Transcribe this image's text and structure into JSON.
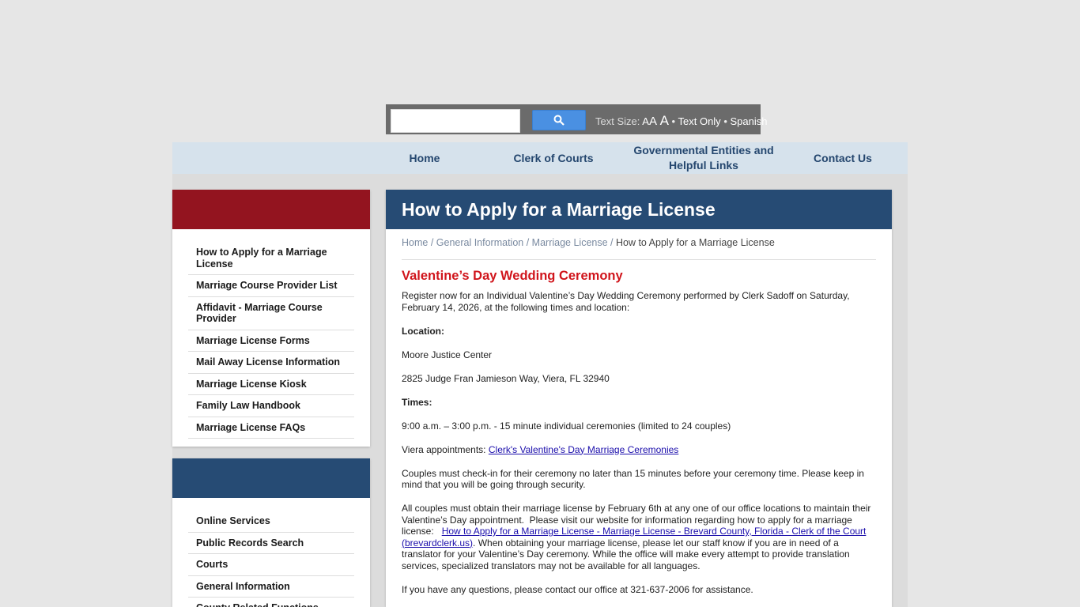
{
  "utility": {
    "search_placeholder": "",
    "text_size_label": "Text Size:",
    "size_small": "A",
    "size_medium": "A",
    "size_large": "A",
    "bullet1": "•",
    "text_only": "Text Only",
    "bullet2": "•",
    "spanish": "Spanish"
  },
  "nav": {
    "items": [
      {
        "label": "Home"
      },
      {
        "label": "Clerk of Courts"
      },
      {
        "label": "Governmental Entities and Helpful Links"
      },
      {
        "label": "Contact Us"
      }
    ]
  },
  "sidebar": {
    "section1": {
      "header_color": "#93141f",
      "items": [
        {
          "label": "How to Apply for a Marriage License"
        },
        {
          "label": "Marriage Course Provider List"
        },
        {
          "label": "Affidavit - Marriage Course Provider"
        },
        {
          "label": "Marriage License Forms"
        },
        {
          "label": "Mail Away License Information"
        },
        {
          "label": "Marriage License Kiosk"
        },
        {
          "label": "Family Law Handbook"
        },
        {
          "label": "Marriage License FAQs"
        }
      ]
    },
    "section2": {
      "header_color": "#264b74",
      "items": [
        {
          "label": "Online Services"
        },
        {
          "label": "Public Records Search"
        },
        {
          "label": "Courts"
        },
        {
          "label": "General Information"
        },
        {
          "label": "County Related Functions"
        }
      ]
    }
  },
  "main": {
    "title": "How to Apply for a Marriage License",
    "breadcrumb": [
      {
        "label": "Home"
      },
      {
        "label": "General Information"
      },
      {
        "label": "Marriage License"
      },
      {
        "label": "How to Apply for a Marriage License"
      }
    ],
    "breadcrumb_sep": " / ",
    "heading": "Valentine’s Day Wedding Ceremony",
    "intro": "Register now for an Individual Valentine’s Day Wedding Ceremony performed by Clerk Sadoff on Saturday, February 14, 2026, at the following times and location:",
    "location_label": "Location:",
    "location_name": "Moore Justice Center",
    "location_address": "2825 Judge Fran Jamieson Way, Viera, FL  32940",
    "times_label": "Times:",
    "times_value": "9:00 a.m. – 3:00 p.m. - 15 minute individual ceremonies (limited to 24 couples)",
    "appointments_label": "Viera appointments: ",
    "appointments_link": "Clerk's Valentine's Day Marriage Ceremonies",
    "checkin": "Couples must check-in for their ceremony no later than 15 minutes before your ceremony time. Please keep in mind that you will be going through security.",
    "obtain_text1": "All couples must obtain their marriage license by February 6th at any one of our office locations to maintain their Valentine’s Day appointment.  Please visit our website for information regarding how to apply for a marriage license:   ",
    "obtain_link": "How to Apply for a Marriage License - Marriage License - Brevard County, Florida - Clerk of the Court  (brevardclerk.us)",
    "obtain_text2": ".  When obtaining your marriage license, please let our staff know if you are in need of a translator for your Valentine’s Day ceremony.  While the office will make every attempt to provide translation services, specialized translators may not be available for all languages.",
    "questions": "If you have any questions, please contact our office at 321-637-2006 for assistance."
  }
}
